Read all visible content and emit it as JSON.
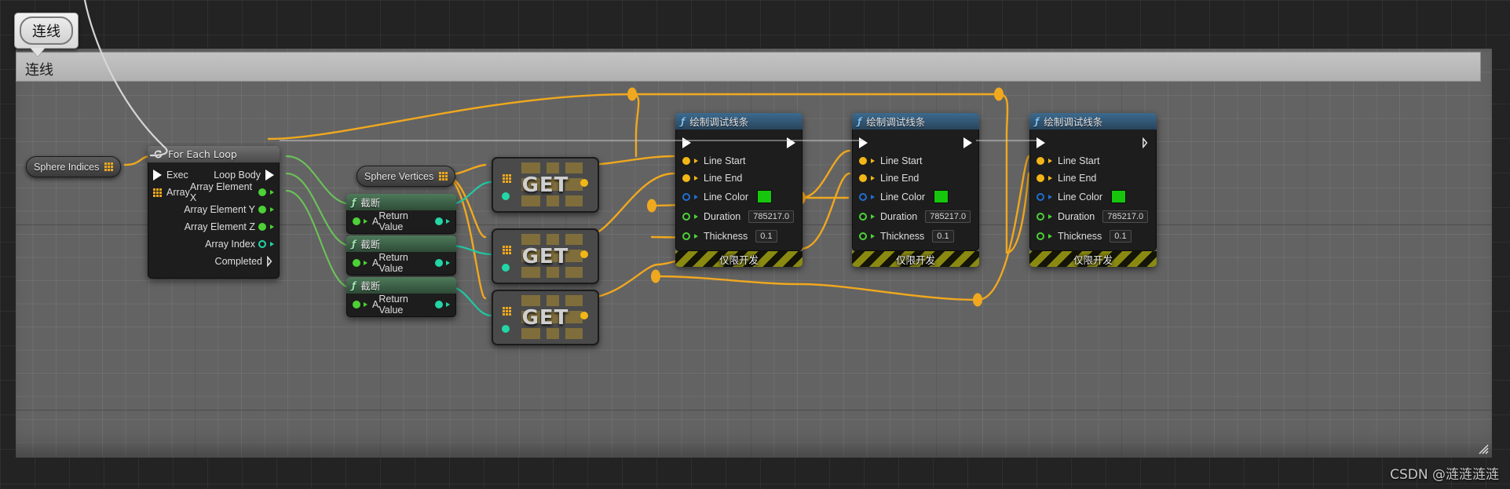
{
  "window": {
    "callout_label": "连线",
    "title": "连线",
    "watermark": "CSDN @涟涟涟涟"
  },
  "icons": {
    "loop": "loop-icon",
    "function": "function-f-icon",
    "array_grid": "array-grid-icon",
    "resize_grip": "resize-grip-icon"
  },
  "colors": {
    "exec_white": "#ffffff",
    "array_orange": "#f0a81e",
    "vector_gold": "#f3b617",
    "float_green": "#4cd137",
    "int_cyan": "#23d6a5",
    "linear_color_blue": "#1f6fd0",
    "line_color_swatch": "#16c60c",
    "wire_orange": "#f0a81e",
    "wire_green": "#6bbf5a",
    "wire_cyan": "#21c9a3",
    "wire_white": "#cfcfcf"
  },
  "nodes": {
    "sphere_indices": {
      "label": "Sphere Indices",
      "pin_icon": "array-grid-icon"
    },
    "sphere_vertices": {
      "label": "Sphere Vertices",
      "pin_icon": "array-grid-icon"
    },
    "for_each_loop": {
      "title": "For Each Loop",
      "inputs": [
        {
          "label": "Exec",
          "type": "exec"
        },
        {
          "label": "Array",
          "type": "array"
        }
      ],
      "outputs": [
        {
          "label": "Loop Body",
          "type": "exec"
        },
        {
          "label": "Array Element X",
          "type": "float"
        },
        {
          "label": "Array Element Y",
          "type": "float"
        },
        {
          "label": "Array Element Z",
          "type": "float"
        },
        {
          "label": "Array Index",
          "type": "int"
        },
        {
          "label": "Completed",
          "type": "exec"
        }
      ]
    },
    "truncate": {
      "title": "截断",
      "input_label": "A",
      "output_label": "Return Value"
    },
    "get": {
      "label": "GET"
    },
    "draw_debug_line": {
      "title": "绘制调试线条",
      "dev_only_label": "仅限开发",
      "pins": [
        {
          "label": "Line Start",
          "type": "vector",
          "value": ""
        },
        {
          "label": "Line End",
          "type": "vector",
          "value": ""
        },
        {
          "label": "Line Color",
          "type": "linearcolor",
          "value": "#16c60c"
        },
        {
          "label": "Duration",
          "type": "float",
          "value": "785217.0"
        },
        {
          "label": "Thickness",
          "type": "float",
          "value": "0.1"
        }
      ]
    }
  },
  "instances": {
    "truncate_nodes": [
      {
        "id": "truncate-1"
      },
      {
        "id": "truncate-2"
      },
      {
        "id": "truncate-3"
      }
    ],
    "get_nodes": [
      {
        "id": "get-1"
      },
      {
        "id": "get-2"
      },
      {
        "id": "get-3"
      }
    ],
    "draw_debug_nodes": [
      {
        "id": "draw-debug-1"
      },
      {
        "id": "draw-debug-2"
      },
      {
        "id": "draw-debug-3"
      }
    ]
  }
}
